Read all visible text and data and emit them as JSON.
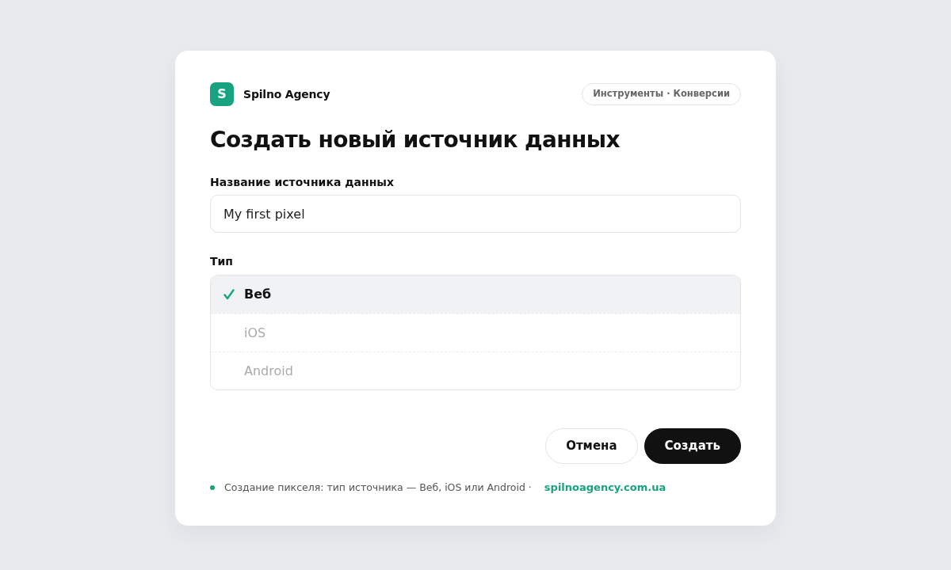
{
  "brand": {
    "logo_letter": "S",
    "name": "Spilno Agency"
  },
  "breadcrumb": "Инструменты · Конверсии",
  "title": "Создать новый источник данных",
  "name_field": {
    "label": "Название источника данных",
    "value": "My first pixel"
  },
  "type_field": {
    "label": "Тип",
    "options": [
      {
        "label": "Веб",
        "selected": true
      },
      {
        "label": "iOS",
        "selected": false
      },
      {
        "label": "Android",
        "selected": false
      }
    ]
  },
  "buttons": [
    {
      "label": "Отмена",
      "kind": "secondary"
    },
    {
      "label": "Создать",
      "kind": "primary"
    }
  ],
  "footer": {
    "text": "Создание пикселя: тип источника — Веб, iOS или Android ·",
    "link": "spilnoagency.com.ua"
  }
}
